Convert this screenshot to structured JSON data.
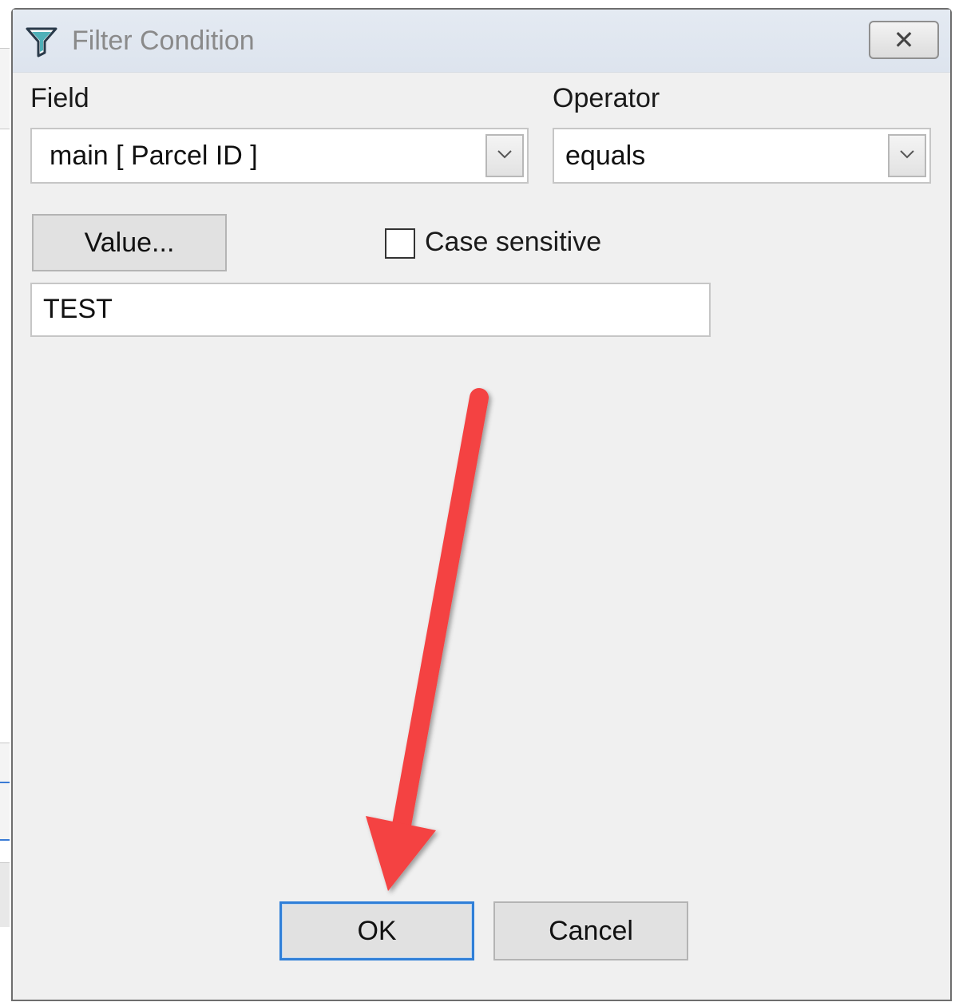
{
  "dialog": {
    "title": "Filter Condition",
    "close_label": "✕"
  },
  "field": {
    "label": "Field",
    "value": "main [ Parcel ID ]"
  },
  "operator": {
    "label": "Operator",
    "value": "equals"
  },
  "value_button": {
    "label": "Value..."
  },
  "case_sensitive": {
    "label": "Case sensitive",
    "checked": false
  },
  "value_input": {
    "value": "TEST"
  },
  "buttons": {
    "ok": "OK",
    "cancel": "Cancel"
  },
  "annotation": {
    "arrow_color": "#f44242"
  }
}
